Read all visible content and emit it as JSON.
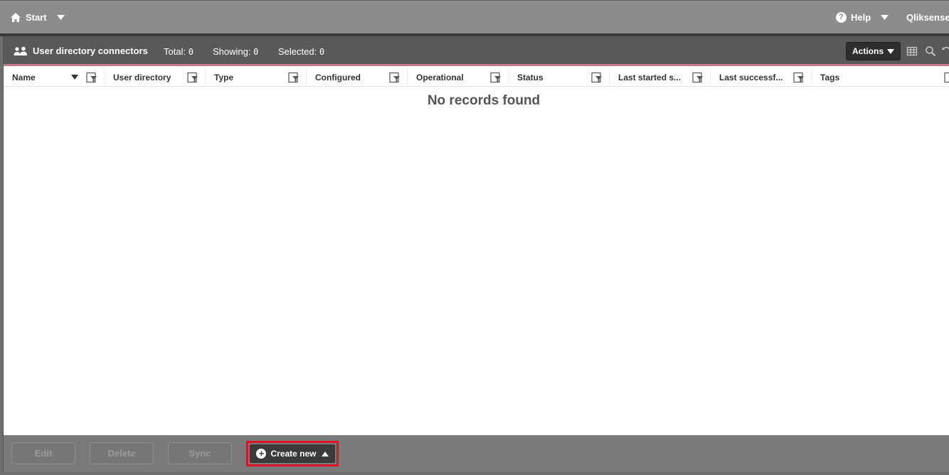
{
  "topbar": {
    "start_label": "Start",
    "help_label": "Help",
    "user_label": "Qliksense"
  },
  "header": {
    "title": "User directory connectors",
    "total_label": "Total:",
    "total_value": "0",
    "showing_label": "Showing:",
    "showing_value": "0",
    "selected_label": "Selected:",
    "selected_value": "0",
    "actions_label": "Actions"
  },
  "columns": [
    {
      "label": "Name",
      "sorted": true
    },
    {
      "label": "User directory"
    },
    {
      "label": "Type"
    },
    {
      "label": "Configured"
    },
    {
      "label": "Operational"
    },
    {
      "label": "Status"
    },
    {
      "label": "Last started s..."
    },
    {
      "label": "Last successf..."
    },
    {
      "label": "Tags"
    }
  ],
  "table": {
    "empty_message": "No records found"
  },
  "footer": {
    "edit_label": "Edit",
    "delete_label": "Delete",
    "sync_label": "Sync",
    "create_label": "Create new"
  },
  "colors": {
    "highlight": "#e0102a",
    "header_bg": "#595959",
    "header_underline": "#c97a8a"
  }
}
